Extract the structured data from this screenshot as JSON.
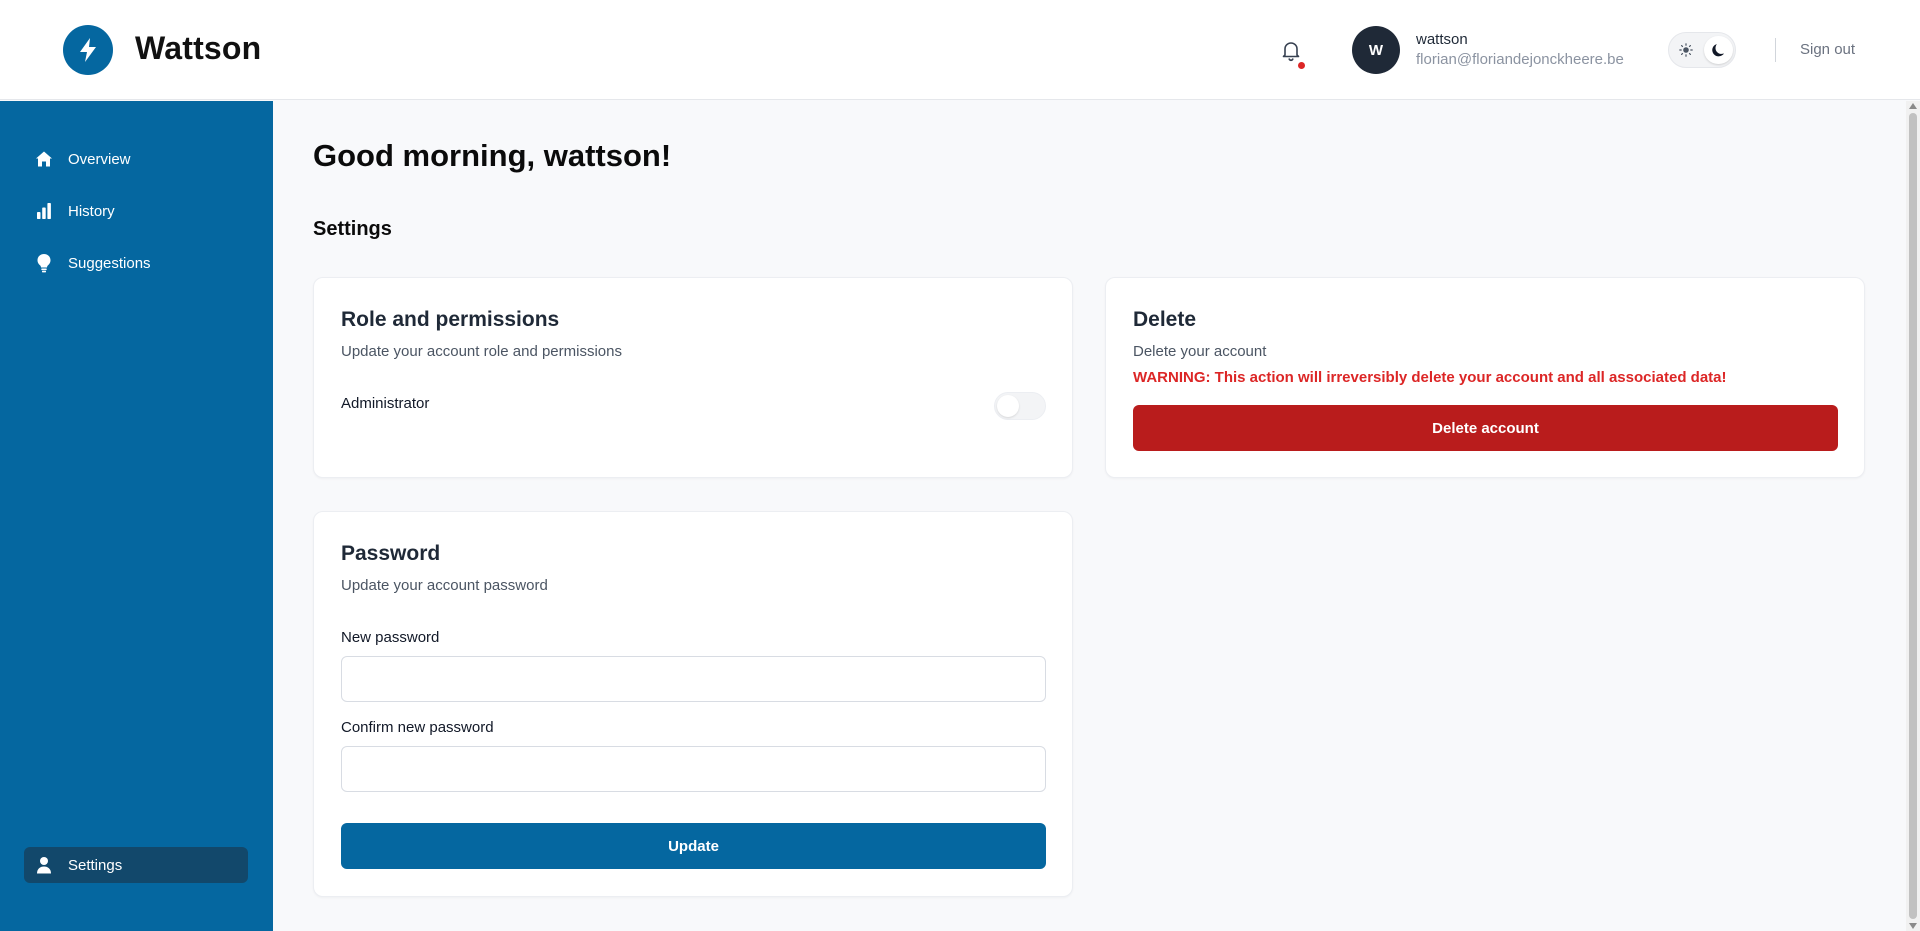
{
  "app": {
    "brand": "Wattson",
    "logo_icon": "bolt-icon",
    "accent_color": "#0567a0",
    "sidebar_active_color": "#12486b",
    "danger_color": "#b91c1c",
    "warning_text_color": "#dc2626"
  },
  "header": {
    "notification_icon": "bell-icon",
    "has_unread_notifications": true,
    "user": {
      "avatar_initial": "W",
      "name": "wattson",
      "email": "florian@floriandejonckheere.be"
    },
    "theme_toggle": {
      "light_icon": "sun-icon",
      "dark_icon": "moon-icon",
      "selected": "dark"
    },
    "signout_label": "Sign out"
  },
  "sidebar": {
    "items": [
      {
        "label": "Overview",
        "icon": "home-icon",
        "active": false
      },
      {
        "label": "History",
        "icon": "bar-chart-icon",
        "active": false
      },
      {
        "label": "Suggestions",
        "icon": "lightbulb-icon",
        "active": false
      }
    ],
    "bottom_item": {
      "label": "Settings",
      "icon": "user-icon",
      "active": true
    }
  },
  "main": {
    "greeting": "Good morning, wattson!",
    "section_title": "Settings",
    "role_card": {
      "title": "Role and permissions",
      "subtitle": "Update your account role and permissions",
      "administrator_label": "Administrator",
      "administrator_enabled": false
    },
    "delete_card": {
      "title": "Delete",
      "subtitle": "Delete your account",
      "warning": "WARNING: This action will irreversibly delete your account and all associated data!",
      "button_label": "Delete account"
    },
    "password_card": {
      "title": "Password",
      "subtitle": "Update your account password",
      "new_password_label": "New password",
      "new_password_value": "",
      "confirm_password_label": "Confirm new password",
      "confirm_password_value": "",
      "button_label": "Update"
    }
  }
}
